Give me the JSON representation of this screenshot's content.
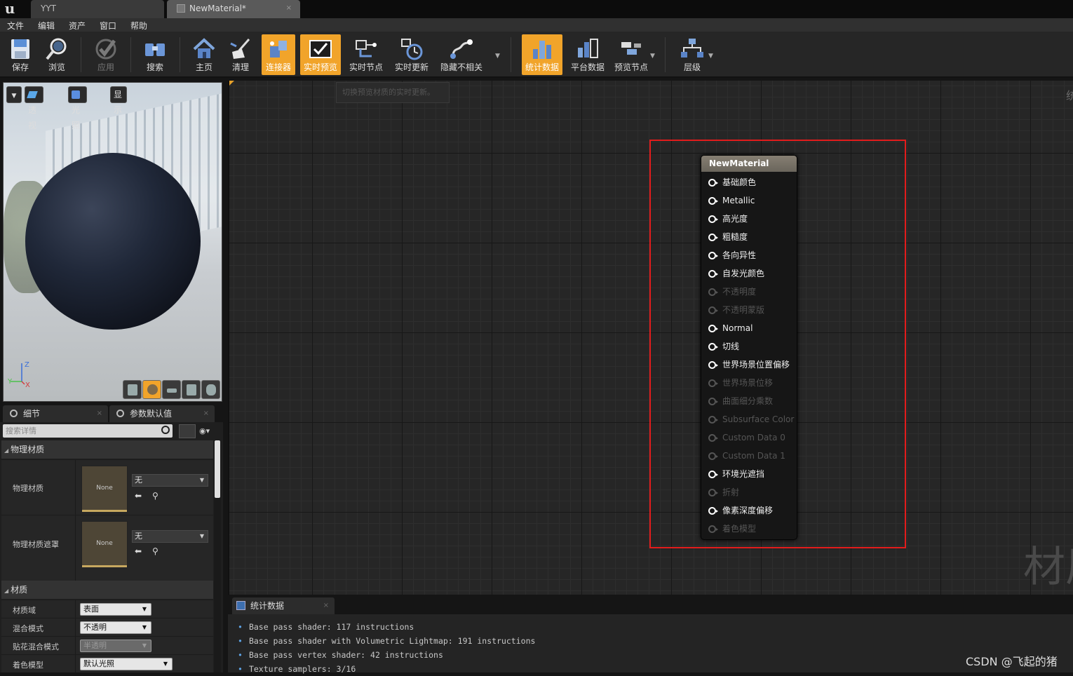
{
  "titlebar": {
    "project_tab": "YYT",
    "material_tab": "NewMaterial*",
    "close_glyph": "×"
  },
  "menu": [
    "文件",
    "编辑",
    "资产",
    "窗口",
    "帮助"
  ],
  "toolbar": {
    "buttons": [
      {
        "label": "保存",
        "icon": "save-icon"
      },
      {
        "label": "浏览",
        "icon": "browse-icon"
      },
      {
        "label": "应用",
        "icon": "apply-icon"
      },
      {
        "label": "搜索",
        "icon": "search-icon"
      },
      {
        "label": "主页",
        "icon": "home-icon"
      },
      {
        "label": "清理",
        "icon": "clean-icon"
      },
      {
        "label": "连接器",
        "icon": "connector-icon"
      },
      {
        "label": "实时预览",
        "icon": "live-preview-icon"
      },
      {
        "label": "实时节点",
        "icon": "live-nodes-icon"
      },
      {
        "label": "实时更新",
        "icon": "live-update-icon"
      },
      {
        "label": "隐藏不相关",
        "icon": "hide-unrelated-icon"
      },
      {
        "label": "统计数据",
        "icon": "stats-icon"
      },
      {
        "label": "平台数据",
        "icon": "platform-stats-icon"
      },
      {
        "label": "预览节点",
        "icon": "preview-node-icon"
      },
      {
        "label": "层级",
        "icon": "hierarchy-icon"
      }
    ],
    "active_color": "#f1a42a"
  },
  "viewport": {
    "perspective_label": "透视",
    "lit_label": "光照",
    "show_label": "显示",
    "axis_z": "Z",
    "axis_y": "Y",
    "axis_x": "X"
  },
  "details": {
    "tab_details": "细节",
    "tab_params": "参数默认值",
    "search_placeholder": "搜索详情",
    "section_physical": "物理材质",
    "phys_mat_label": "物理材质",
    "phys_mat_thumb": "None",
    "phys_mat_value": "无",
    "phys_mask_label": "物理材质遮罩",
    "phys_mask_thumb": "None",
    "phys_mask_value": "无",
    "section_material": "材质",
    "domain_label": "材质域",
    "domain_value": "表面",
    "blend_label": "混合模式",
    "blend_value": "不透明",
    "decal_label": "贴花混合模式",
    "decal_value": "半透明",
    "shading_label": "着色模型",
    "shading_value": "默认光照"
  },
  "graph": {
    "tooltip": "切换预览材质的实时更新。",
    "watermark": "材质",
    "edge_glyph": "统"
  },
  "node": {
    "title": "NewMaterial",
    "pins": [
      {
        "label": "基础颜色",
        "enabled": true
      },
      {
        "label": "Metallic",
        "enabled": true
      },
      {
        "label": "高光度",
        "enabled": true
      },
      {
        "label": "粗糙度",
        "enabled": true
      },
      {
        "label": "各向异性",
        "enabled": true
      },
      {
        "label": "自发光颜色",
        "enabled": true
      },
      {
        "label": "不透明度",
        "enabled": false
      },
      {
        "label": "不透明蒙版",
        "enabled": false
      },
      {
        "label": "Normal",
        "enabled": true
      },
      {
        "label": "切线",
        "enabled": true
      },
      {
        "label": "世界场景位置偏移",
        "enabled": true
      },
      {
        "label": "世界场景位移",
        "enabled": false
      },
      {
        "label": "曲面细分乘数",
        "enabled": false
      },
      {
        "label": "Subsurface Color",
        "enabled": false
      },
      {
        "label": "Custom Data 0",
        "enabled": false
      },
      {
        "label": "Custom Data 1",
        "enabled": false
      },
      {
        "label": "环境光遮挡",
        "enabled": true
      },
      {
        "label": "折射",
        "enabled": false
      },
      {
        "label": "像素深度偏移",
        "enabled": true
      },
      {
        "label": "着色模型",
        "enabled": false
      }
    ],
    "highlight_color": "#e21c1c"
  },
  "stats": {
    "tab_label": "统计数据",
    "lines": [
      "Base pass shader: 117 instructions",
      "Base pass shader with Volumetric Lightmap: 191 instructions",
      "Base pass vertex shader: 42 instructions",
      "Texture samplers: 3/16"
    ]
  },
  "credit": "CSDN @飞起的猪"
}
